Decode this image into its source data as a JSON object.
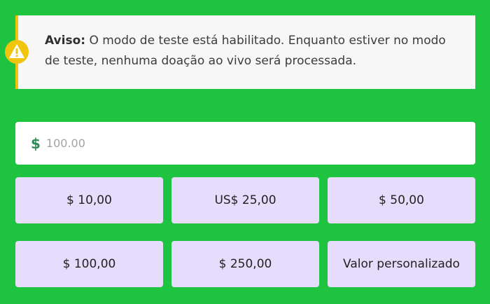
{
  "notice": {
    "title": "Aviso:",
    "message": " O modo de teste está habilitado. Enquanto estiver no modo de teste, nenhuma doação ao vivo será processada."
  },
  "amount": {
    "currency_symbol": "$",
    "placeholder": "100.00"
  },
  "presets": {
    "items": [
      {
        "label": "$ 10,00"
      },
      {
        "label": "US$ 25,00"
      },
      {
        "label": "$ 50,00"
      },
      {
        "label": "$ 100,00"
      },
      {
        "label": "$ 250,00"
      },
      {
        "label": "Valor personalizado"
      }
    ]
  },
  "colors": {
    "background": "#1ec43f",
    "notice_background": "#f7f7f7",
    "notice_accent": "#f1c40f",
    "currency": "#2e8b57",
    "preset_button": "#e6dcfb"
  },
  "icons": {
    "notice": "warning-icon"
  }
}
